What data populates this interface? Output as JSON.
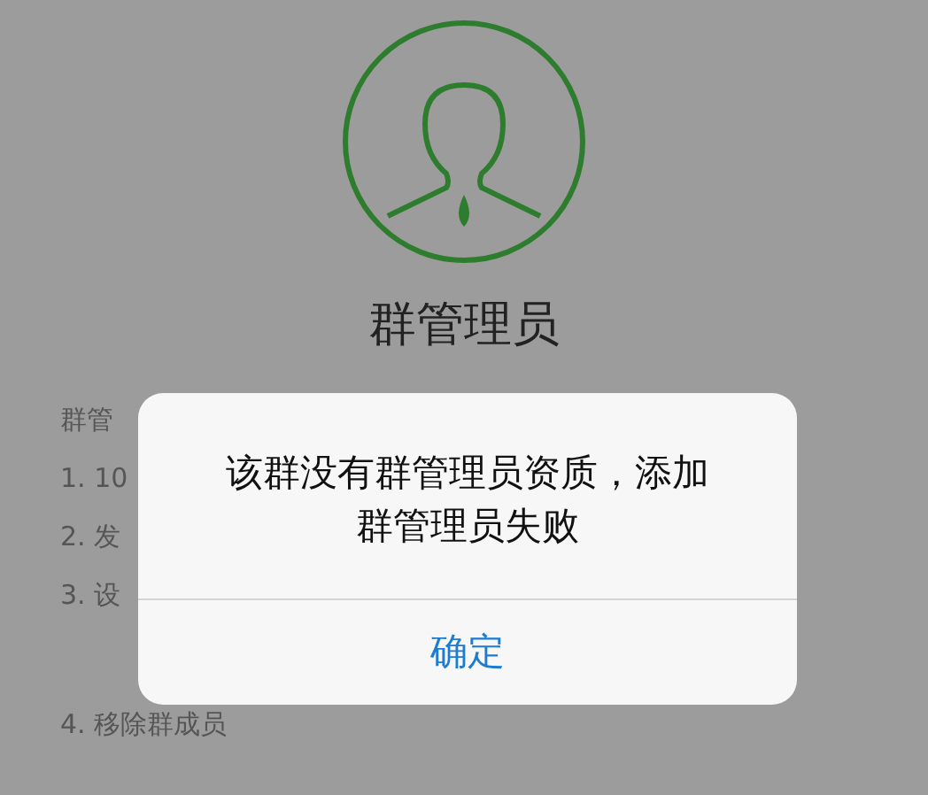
{
  "page": {
    "title": "群管理员",
    "lines": [
      "群管",
      "1. 10",
      "2. 发",
      "3. 设",
      "4. 移除群成员"
    ]
  },
  "dialog": {
    "message": "该群没有群管理员资质，添加群管理员失败",
    "button": "确定"
  }
}
